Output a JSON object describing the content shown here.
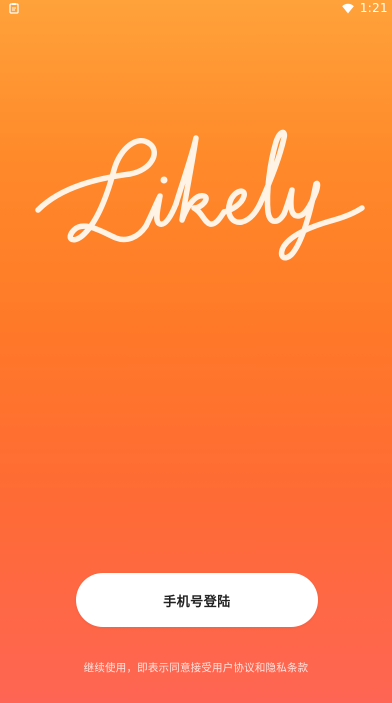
{
  "status_bar": {
    "time": "1:21",
    "left_icon": "clipboard-icon",
    "signal_icon": "wifi-icon"
  },
  "logo": {
    "text": "Likely",
    "color": "#fff3e6"
  },
  "login": {
    "button_label": "手机号登陆"
  },
  "terms": {
    "text": "继续使用，即表示同意接受用户协议和隐私条款"
  },
  "colors": {
    "gradient_top": "#ffa23a",
    "gradient_bottom": "#ff6554",
    "button_bg": "#ffffff"
  }
}
